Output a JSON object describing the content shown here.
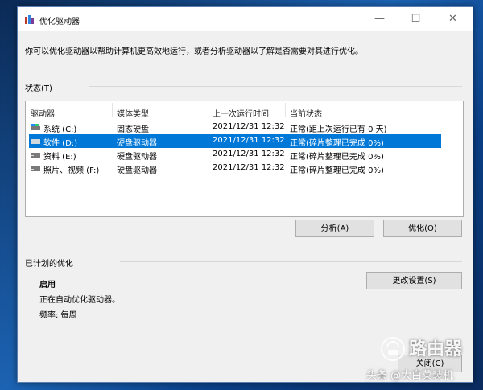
{
  "window": {
    "title": "优化驱动器",
    "minimize_glyph": "—",
    "maximize_glyph": "☐",
    "close_glyph": "✕"
  },
  "description": "你可以优化驱动器以帮助计算机更高效地运行，或者分析驱动器以了解是否需要对其进行优化。",
  "status_section": {
    "label": "状态(T)",
    "headers": [
      "驱动器",
      "媒体类型",
      "上一次运行时间",
      "当前状态"
    ],
    "rows": [
      {
        "drive": "系统 (C:)",
        "media": "固态硬盘",
        "last_run": "2021/12/31 12:32",
        "status": "正常(距上次运行已有 0 天)",
        "selected": false
      },
      {
        "drive": "软件 (D:)",
        "media": "硬盘驱动器",
        "last_run": "2021/12/31 12:32",
        "status": "正常(碎片整理已完成 0%)",
        "selected": true
      },
      {
        "drive": "资料 (E:)",
        "media": "硬盘驱动器",
        "last_run": "2021/12/31 12:32",
        "status": "正常(碎片整理已完成 0%)",
        "selected": false
      },
      {
        "drive": "照片、视频 (F:)",
        "media": "硬盘驱动器",
        "last_run": "2021/12/31 12:32",
        "status": "正常(碎片整理已完成 0%)",
        "selected": false
      }
    ]
  },
  "buttons": {
    "analyze": "分析(A)",
    "optimize": "优化(O)",
    "change_settings": "更改设置(S)",
    "close": "关闭(C)"
  },
  "scheduled_section": {
    "label": "已计划的优化",
    "state": "启用",
    "detail": "正在自动优化驱动器。",
    "frequency": "频率: 每周"
  },
  "watermark": {
    "brand": "路由器",
    "caption": "头条 @大白菜装机"
  },
  "colors": {
    "selection": "#0078d7",
    "window_bg": "#f0f0f0"
  }
}
